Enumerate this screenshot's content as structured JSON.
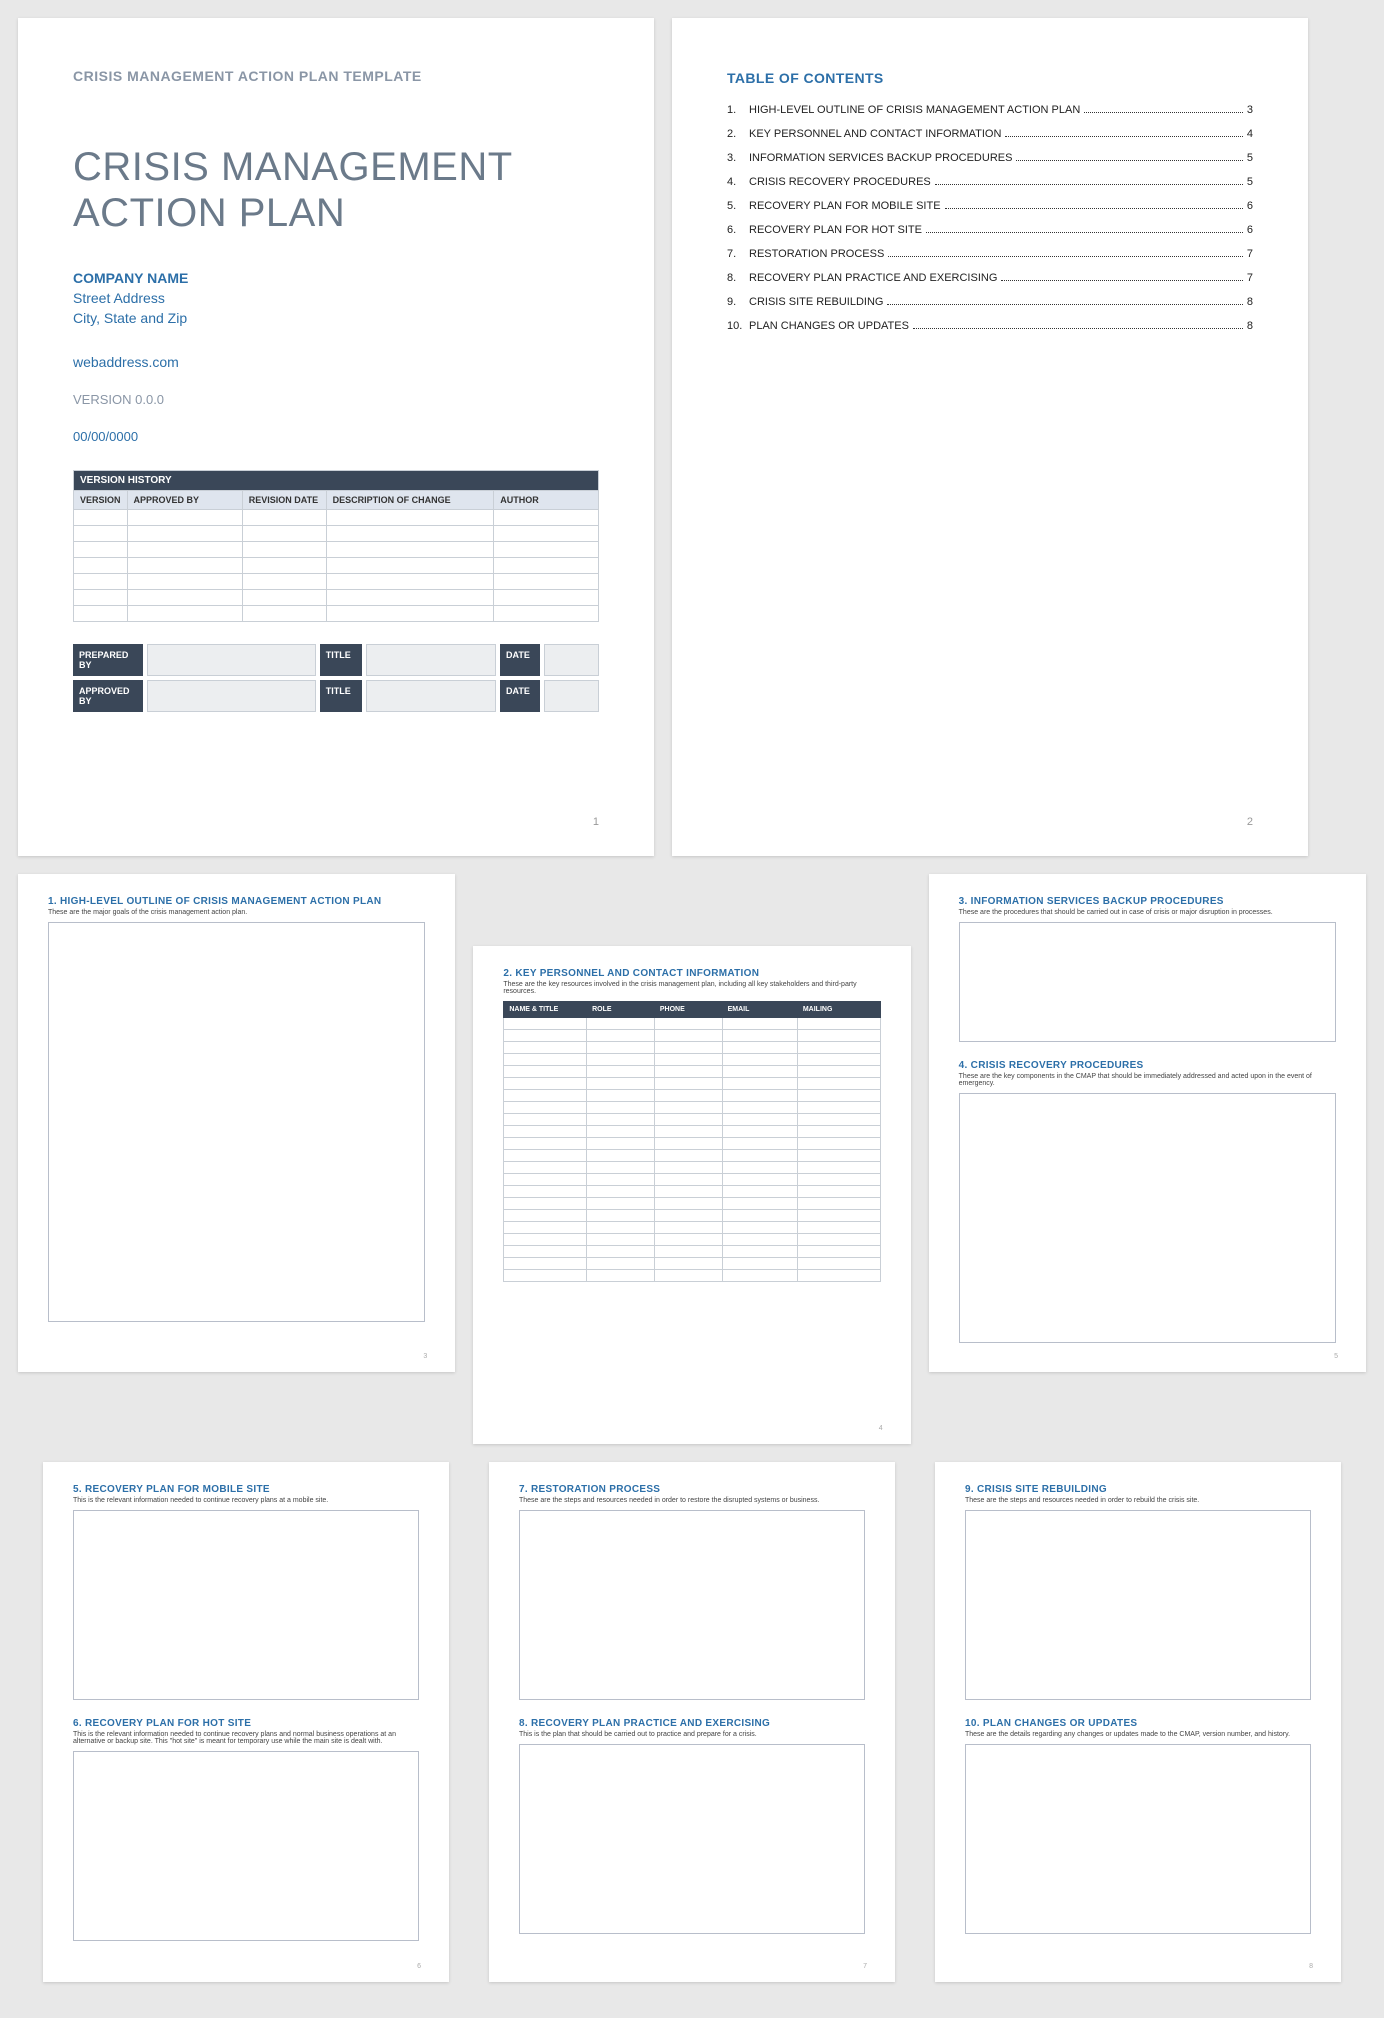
{
  "page1": {
    "templateLabel": "CRISIS MANAGEMENT ACTION PLAN TEMPLATE",
    "titleLine1": "CRISIS MANAGEMENT",
    "titleLine2": "ACTION PLAN",
    "company": "COMPANY NAME",
    "address1": "Street Address",
    "address2": "City, State and Zip",
    "web": "webaddress.com",
    "version": "VERSION 0.0.0",
    "date": "00/00/0000",
    "vhTitle": "VERSION HISTORY",
    "vhHeaders": {
      "c1": "VERSION",
      "c2": "APPROVED BY",
      "c3": "REVISION DATE",
      "c4": "DESCRIPTION OF CHANGE",
      "c5": "AUTHOR"
    },
    "sig": {
      "prepared": "PREPARED BY",
      "approved": "APPROVED BY",
      "title": "TITLE",
      "date": "DATE"
    },
    "pageNum": "1"
  },
  "page2": {
    "tocTitle": "TABLE OF CONTENTS",
    "items": [
      {
        "n": "1.",
        "label": "HIGH-LEVEL OUTLINE OF CRISIS MANAGEMENT ACTION PLAN",
        "p": "3"
      },
      {
        "n": "2.",
        "label": "KEY PERSONNEL AND CONTACT INFORMATION",
        "p": "4"
      },
      {
        "n": "3.",
        "label": "INFORMATION SERVICES BACKUP PROCEDURES",
        "p": "5"
      },
      {
        "n": "4.",
        "label": "CRISIS RECOVERY PROCEDURES",
        "p": "5"
      },
      {
        "n": "5.",
        "label": "RECOVERY PLAN FOR MOBILE SITE",
        "p": "6"
      },
      {
        "n": "6.",
        "label": "RECOVERY PLAN FOR HOT SITE",
        "p": "6"
      },
      {
        "n": "7.",
        "label": "RESTORATION PROCESS",
        "p": "7"
      },
      {
        "n": "8.",
        "label": "RECOVERY PLAN PRACTICE AND EXERCISING",
        "p": "7"
      },
      {
        "n": "9.",
        "label": "CRISIS SITE REBUILDING",
        "p": "8"
      },
      {
        "n": "10.",
        "label": "PLAN CHANGES OR UPDATES",
        "p": "8"
      }
    ],
    "pageNum": "2"
  },
  "page3": {
    "h": "1.  HIGH-LEVEL OUTLINE OF CRISIS MANAGEMENT ACTION PLAN",
    "sub": "These are the major goals of the crisis management action plan.",
    "pageNum": "3"
  },
  "page4": {
    "h": "2.  KEY PERSONNEL AND CONTACT INFORMATION",
    "sub": "These are the key resources involved in the crisis management plan, including all key stakeholders and third-party resources.",
    "headers": {
      "c1": "NAME & TITLE",
      "c2": "ROLE",
      "c3": "PHONE",
      "c4": "EMAIL",
      "c5": "MAILING"
    },
    "pageNum": "4"
  },
  "page5": {
    "s1": {
      "h": "3.  INFORMATION SERVICES BACKUP PROCEDURES",
      "sub": "These are the procedures that should be carried out in case of crisis or major disruption in processes."
    },
    "s2": {
      "h": "4.  CRISIS RECOVERY PROCEDURES",
      "sub": "These are the key components in the CMAP that should be immediately addressed and acted upon in the event of emergency."
    },
    "pageNum": "5"
  },
  "page6": {
    "s1": {
      "h": "5.  RECOVERY PLAN FOR MOBILE SITE",
      "sub": "This is the relevant information needed to continue recovery plans at a mobile site."
    },
    "s2": {
      "h": "6.  RECOVERY PLAN FOR HOT SITE",
      "sub": "This is the relevant information needed to continue recovery plans and normal business operations at an alternative or backup site. This \"hot site\" is meant for temporary use while the main site is dealt with."
    },
    "pageNum": "6"
  },
  "page7": {
    "s1": {
      "h": "7.  RESTORATION PROCESS",
      "sub": "These are the steps and resources needed in order to restore the disrupted systems or business."
    },
    "s2": {
      "h": "8.  RECOVERY PLAN PRACTICE AND EXERCISING",
      "sub": "This is the plan that should be carried out to practice and prepare for a crisis."
    },
    "pageNum": "7"
  },
  "page8": {
    "s1": {
      "h": "9.  CRISIS SITE REBUILDING",
      "sub": "These are the steps and resources needed in order to rebuild the crisis site."
    },
    "s2": {
      "h": "10.   PLAN CHANGES OR UPDATES",
      "sub": "These are the details regarding any changes or updates made to the CMAP, version number, and history."
    },
    "pageNum": "8"
  }
}
